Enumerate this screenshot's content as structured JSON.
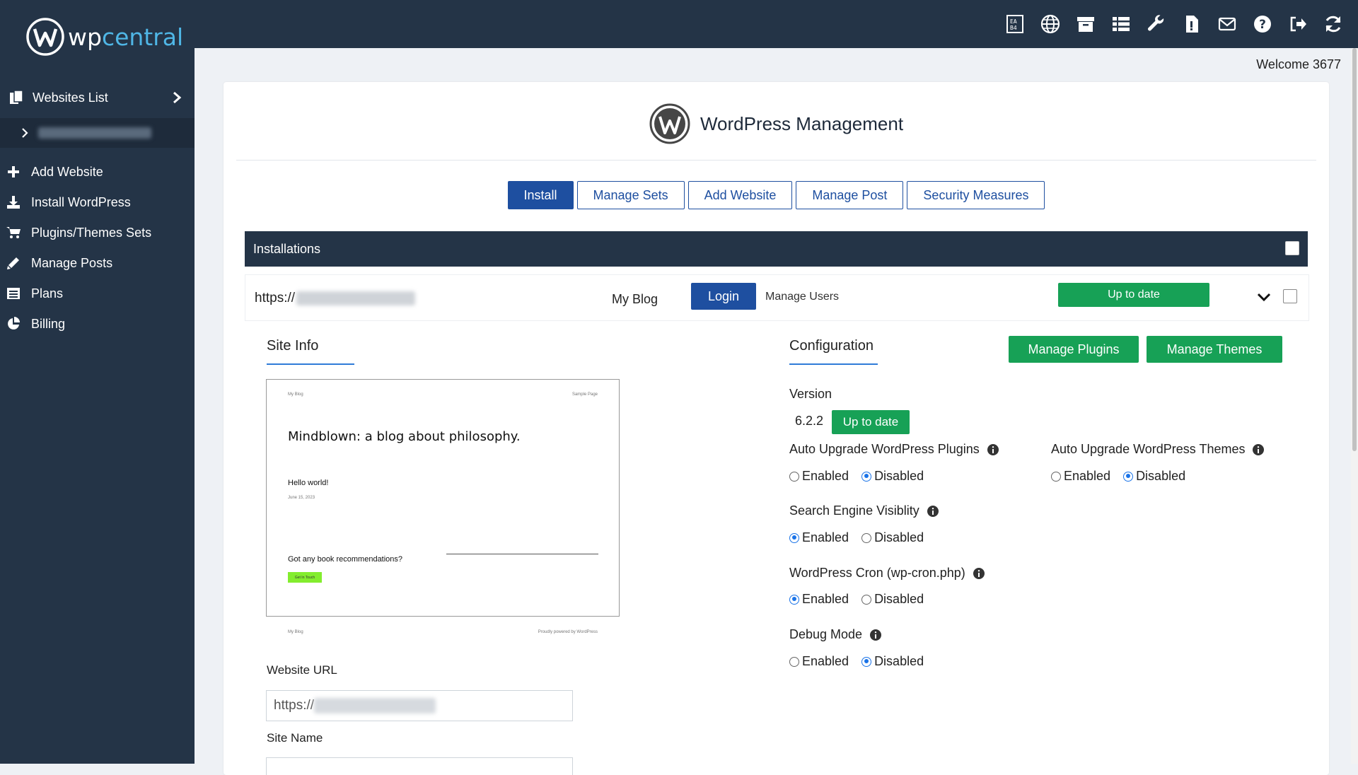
{
  "brand": {
    "logo_word1": "wp",
    "logo_word2": "central"
  },
  "topbar": {
    "icons": [
      "ea-logo-icon",
      "globe-icon",
      "archive-icon",
      "list-icon",
      "wrench-icon",
      "file-icon",
      "mail-icon",
      "help-icon",
      "logout-icon",
      "refresh-icon"
    ]
  },
  "sidebar": {
    "websites_list": "Websites List",
    "items": [
      {
        "label": "Add Website",
        "icon": "plus-icon"
      },
      {
        "label": "Install WordPress",
        "icon": "download-icon"
      },
      {
        "label": "Plugins/Themes Sets",
        "icon": "cart-icon"
      },
      {
        "label": "Manage Posts",
        "icon": "pencil-icon"
      },
      {
        "label": "Plans",
        "icon": "list-alt-icon"
      },
      {
        "label": "Billing",
        "icon": "pie-chart-icon"
      }
    ]
  },
  "header": {
    "welcome": "Welcome 3677"
  },
  "page": {
    "title": "WordPress Management",
    "tabs": [
      "Install",
      "Manage Sets",
      "Add Website",
      "Manage Post",
      "Security Measures"
    ],
    "active_tab": "Install"
  },
  "installations": {
    "header": "Installations",
    "row": {
      "url_prefix": "https://",
      "site_name": "My Blog",
      "login": "Login",
      "manage_users": "Manage Users",
      "status": "Up to date"
    }
  },
  "site_info": {
    "heading": "Site Info",
    "preview": {
      "top_left": "My Blog",
      "top_right": "Sample Page",
      "headline": "Mindblown: a blog about philosophy.",
      "post_title": "Hello world!",
      "post_date": "June 15, 2023",
      "book_prompt": "Got any book recommendations?",
      "cta": "Get In Touch",
      "footer_left": "My Blog",
      "footer_right": "Proudly powered by WordPress"
    },
    "website_url_label": "Website URL",
    "website_url_value": "https://",
    "site_name_label": "Site Name"
  },
  "configuration": {
    "heading": "Configuration",
    "manage_plugins": "Manage Plugins",
    "manage_themes": "Manage Themes",
    "version_label": "Version",
    "version": "6.2.2",
    "version_status": "Up to date",
    "auto_plugins_label": "Auto Upgrade WordPress Plugins",
    "auto_themes_label": "Auto Upgrade WordPress Themes",
    "search_engine_label": "Search Engine Visiblity",
    "cron_label": "WordPress Cron (wp-cron.php)",
    "debug_label": "Debug Mode",
    "enabled": "Enabled",
    "disabled": "Disabled",
    "auto_plugins": "Disabled",
    "auto_themes": "Disabled",
    "search_engine": "Enabled",
    "cron": "Enabled",
    "debug": "Disabled"
  },
  "colors": {
    "navy": "#243447",
    "blue": "#1e4fa0",
    "green": "#17a156",
    "accent": "#4fb6e6"
  }
}
